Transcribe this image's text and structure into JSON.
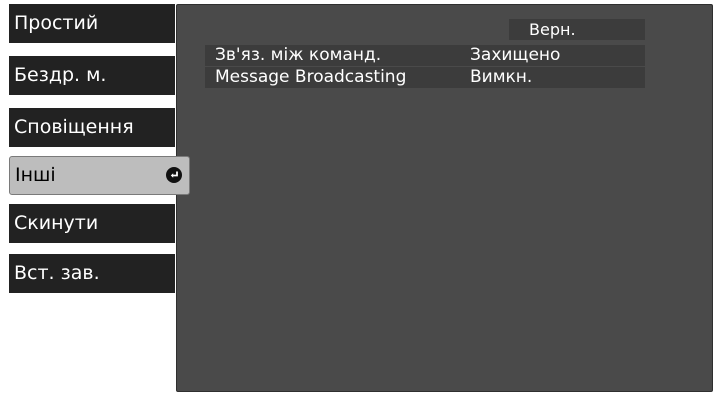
{
  "sidebar": {
    "items": [
      {
        "label": "Простий"
      },
      {
        "label": "Бездр. м."
      },
      {
        "label": "Сповіщення"
      },
      {
        "label": "Інші",
        "selected": true,
        "icon": "enter-icon"
      },
      {
        "label": "Скинути"
      },
      {
        "label": "Вст. зав."
      }
    ]
  },
  "panel": {
    "back_label": "Верн.",
    "rows": [
      {
        "label": "Зв'яз. між команд.",
        "value": "Захищено"
      },
      {
        "label": "Message Broadcasting",
        "value": "Вимкн."
      }
    ]
  },
  "colors": {
    "menu_bg": "#222222",
    "selected_bg": "#bdbdbd",
    "panel_bg": "#4a4a4a",
    "row_bg": "#3c3c3c"
  }
}
